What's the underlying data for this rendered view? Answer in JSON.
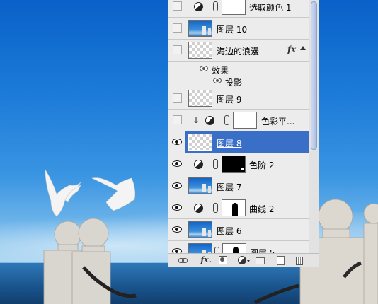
{
  "layers_panel": {
    "layers": [
      {
        "name": "选取颜色 1",
        "visible": false,
        "kind": "adjustment",
        "mask": "white"
      },
      {
        "name": "图层 10",
        "visible": false,
        "kind": "photo"
      },
      {
        "name": "海边的浪漫",
        "visible": false,
        "kind": "transparent",
        "has_fx": true,
        "fx_label": "fx"
      },
      {
        "name": "效果",
        "kind": "effects-group"
      },
      {
        "name": "投影",
        "kind": "effect"
      },
      {
        "name": "图层 9",
        "visible": false,
        "kind": "transparent"
      },
      {
        "name": "色彩平...",
        "visible": false,
        "kind": "adjustment",
        "clipped": true,
        "clip_symbol": "↓",
        "mask": "white"
      },
      {
        "name": "图层 8",
        "visible": true,
        "kind": "transparent",
        "selected": true
      },
      {
        "name": "色阶 2",
        "visible": true,
        "kind": "adjustment",
        "mask": "black"
      },
      {
        "name": "图层 7",
        "visible": true,
        "kind": "photo"
      },
      {
        "name": "曲线 2",
        "visible": true,
        "kind": "adjustment",
        "mask": "curve"
      },
      {
        "name": "图层 6",
        "visible": true,
        "kind": "photo"
      },
      {
        "name": "图层 5",
        "visible": true,
        "kind": "photo-masked"
      }
    ],
    "toolbar": {
      "link": "link-layers-icon",
      "fx": "fx.",
      "mask": "add-mask-icon",
      "adjustment": "new-adjustment-icon",
      "group": "new-group-icon",
      "new_layer": "new-layer-icon",
      "delete": "trash-icon"
    }
  },
  "colors": {
    "panel_bg": "#ececec",
    "selected_row": "#3a6fc7",
    "sky_top": "#0a61c9",
    "sky_bottom": "#9fd0ef"
  }
}
